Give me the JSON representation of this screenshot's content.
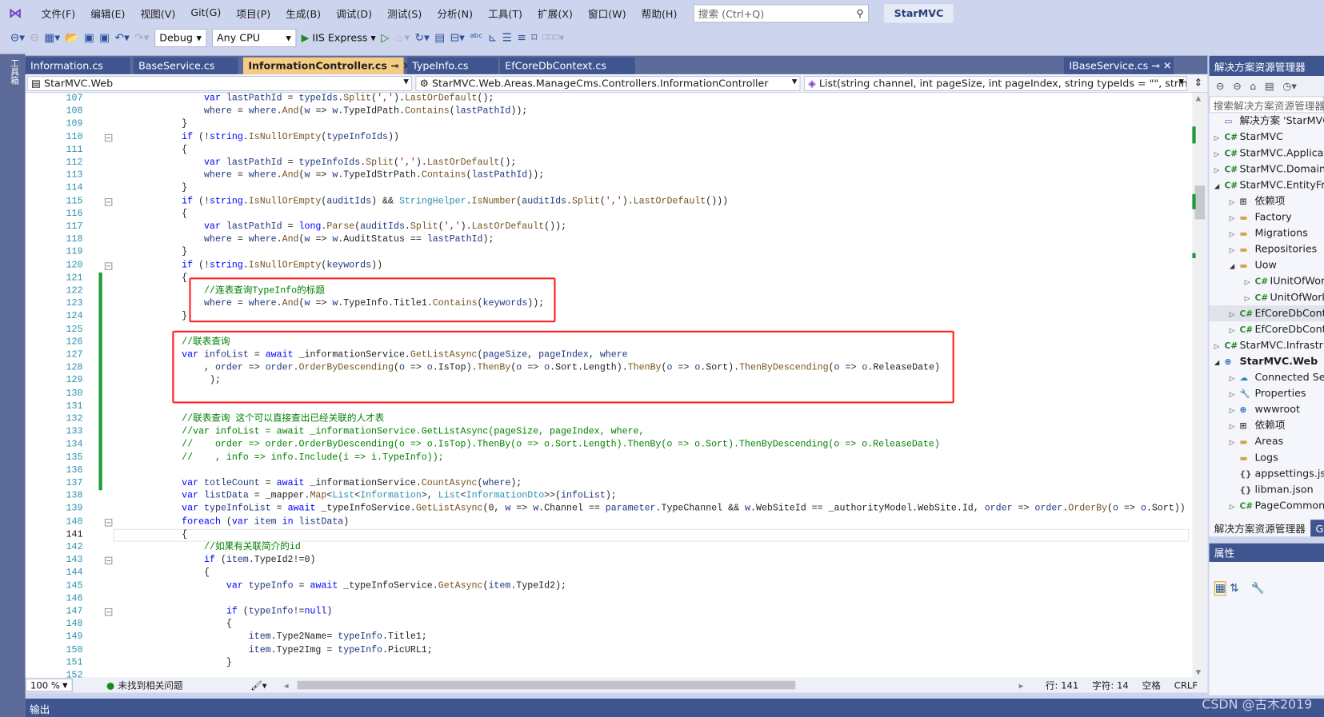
{
  "menu": {
    "logo": "vs-logo",
    "items": [
      "文件(F)",
      "编辑(E)",
      "视图(V)",
      "Git(G)",
      "项目(P)",
      "生成(B)",
      "调试(D)",
      "测试(S)",
      "分析(N)",
      "工具(T)",
      "扩展(X)",
      "窗口(W)",
      "帮助(H)"
    ],
    "search_placeholder": "搜索 (Ctrl+Q)",
    "solution_name": "StarMVC"
  },
  "toolbar": {
    "config": "Debug",
    "platform": "Any CPU",
    "run": "IIS Express"
  },
  "left_strip": "工具箱",
  "tabs": [
    {
      "label": "Information.cs"
    },
    {
      "label": "BaseService.cs"
    },
    {
      "label": "InformationController.cs",
      "active": true
    },
    {
      "label": "TypeInfo.cs"
    },
    {
      "label": "EfCoreDbContext.cs"
    },
    {
      "label": "IBaseService.cs"
    }
  ],
  "nav": {
    "project": "StarMVC.Web",
    "class": "StarMVC.Web.Areas.ManageCms.Controllers.InformationController",
    "member": "List(string channel, int pageSize, int pageIndex, string typeIds = \"\", string typ"
  },
  "code": {
    "first_line": 107,
    "current_line": 141,
    "lines": [
      "                var lastPathId = typeIds.Split(',').LastOrDefault();",
      "                where = where.And(w => w.TypeIdPath.Contains(lastPathId));",
      "            }",
      "            if (!string.IsNullOrEmpty(typeInfoIds))",
      "            {",
      "                var lastPathId = typeInfoIds.Split(',').LastOrDefault();",
      "                where = where.And(w => w.TypeIdStrPath.Contains(lastPathId));",
      "            }",
      "            if (!string.IsNullOrEmpty(auditIds) && StringHelper.IsNumber(auditIds.Split(',').LastOrDefault()))",
      "            {",
      "                var lastPathId = long.Parse(auditIds.Split(',').LastOrDefault());",
      "                where = where.And(w => w.AuditStatus == lastPathId);",
      "            }",
      "            if (!string.IsNullOrEmpty(keywords))",
      "            {",
      "                //连表查询TypeInfo的标题",
      "                where = where.And(w => w.TypeInfo.Title1.Contains(keywords));",
      "            }",
      "",
      "            //联表查询",
      "            var infoList = await _informationService.GetListAsync(pageSize, pageIndex, where",
      "                , order => order.OrderByDescending(o => o.IsTop).ThenBy(o => o.Sort.Length).ThenBy(o => o.Sort).ThenByDescending(o => o.ReleaseDate)",
      "                 );",
      "",
      "",
      "            //联表查询 这个可以直接查出已经关联的人才表",
      "            //var infoList = await _informationService.GetListAsync(pageSize, pageIndex, where,",
      "            //    order => order.OrderByDescending(o => o.IsTop).ThenBy(o => o.Sort.Length).ThenBy(o => o.Sort).ThenByDescending(o => o.ReleaseDate)",
      "            //    , info => info.Include(i => i.TypeInfo));",
      "",
      "            var totleCount = await _informationService.CountAsync(where);",
      "            var listData = _mapper.Map<List<Information>, List<InformationDto>>(infoList);",
      "            var typeInfoList = await _typeInfoService.GetListAsync(0, w => w.Channel == parameter.TypeChannel && w.WebSiteId == _authorityModel.WebSite.Id, order => order.OrderBy(o => o.Sort))",
      "            foreach (var item in listData)",
      "            {",
      "                //如果有关联简介的id",
      "                if (item.TypeId2!=0)",
      "                {",
      "                    var typeInfo = await _typeInfoService.GetAsync(item.TypeId2);",
      "",
      "                    if (typeInfo!=null)",
      "                    {",
      "                        item.Type2Name= typeInfo.Title1;",
      "                        item.Type2Img = typeInfo.PicURL1;",
      "                    }",
      ""
    ]
  },
  "status": {
    "zoom": "100 %",
    "issues": "未找到相关问题",
    "line": "行: 141",
    "col": "字符: 14",
    "ws": "空格",
    "eol": "CRLF"
  },
  "output_label": "输出",
  "watermark": "CSDN @古木2019",
  "solution_explorer": {
    "title": "解决方案资源管理器",
    "search_placeholder": "搜索解决方案资源管理器(",
    "items": [
      {
        "label": "解决方案 'StarMVC'",
        "lvl": 0,
        "icon": "solution",
        "exp": ""
      },
      {
        "label": "StarMVC",
        "lvl": 0,
        "icon": "proj",
        "exp": "▷"
      },
      {
        "label": "StarMVC.Application",
        "lvl": 0,
        "icon": "proj",
        "exp": "▷"
      },
      {
        "label": "StarMVC.Domain",
        "lvl": 0,
        "icon": "proj",
        "exp": "▷"
      },
      {
        "label": "StarMVC.EntityFrameworkCore",
        "lvl": 0,
        "icon": "proj",
        "exp": "◢"
      },
      {
        "label": "依赖项",
        "lvl": 1,
        "icon": "deps",
        "exp": "▷"
      },
      {
        "label": "Factory",
        "lvl": 1,
        "icon": "folder",
        "exp": "▷"
      },
      {
        "label": "Migrations",
        "lvl": 1,
        "icon": "folder",
        "exp": "▷"
      },
      {
        "label": "Repositories",
        "lvl": 1,
        "icon": "folder",
        "exp": "▷"
      },
      {
        "label": "Uow",
        "lvl": 1,
        "icon": "folder",
        "exp": "◢"
      },
      {
        "label": "IUnitOfWork",
        "lvl": 2,
        "icon": "cs",
        "exp": "▷"
      },
      {
        "label": "UnitOfWork",
        "lvl": 2,
        "icon": "cs",
        "exp": "▷"
      },
      {
        "label": "EfCoreDbContext",
        "lvl": 1,
        "icon": "cs",
        "exp": "▷",
        "sel": true
      },
      {
        "label": "EfCoreDbContextFactory",
        "lvl": 1,
        "icon": "cs",
        "exp": "▷"
      },
      {
        "label": "StarMVC.Infrastructure",
        "lvl": 0,
        "icon": "proj",
        "exp": "▷"
      },
      {
        "label": "StarMVC.Web",
        "lvl": 0,
        "icon": "web",
        "exp": "◢",
        "bold": true
      },
      {
        "label": "Connected Services",
        "lvl": 1,
        "icon": "connected",
        "exp": "▷"
      },
      {
        "label": "Properties",
        "lvl": 1,
        "icon": "properties",
        "exp": "▷"
      },
      {
        "label": "wwwroot",
        "lvl": 1,
        "icon": "globe",
        "exp": "▷"
      },
      {
        "label": "依赖项",
        "lvl": 1,
        "icon": "deps",
        "exp": "▷"
      },
      {
        "label": "Areas",
        "lvl": 1,
        "icon": "folder",
        "exp": "▷"
      },
      {
        "label": "Logs",
        "lvl": 1,
        "icon": "folder",
        "exp": ""
      },
      {
        "label": "appsettings.json",
        "lvl": 1,
        "icon": "json",
        "exp": ""
      },
      {
        "label": "libman.json",
        "lvl": 1,
        "icon": "json",
        "exp": ""
      },
      {
        "label": "PageCommon",
        "lvl": 1,
        "icon": "cs",
        "exp": "▷"
      }
    ],
    "bottom_tabs": [
      "解决方案资源管理器",
      "Git 更改"
    ]
  },
  "properties": {
    "title": "属性"
  },
  "colors": {
    "accent": "#3f5590",
    "highlight_box": "#ff2020",
    "active_tab": "#f5cc84"
  }
}
